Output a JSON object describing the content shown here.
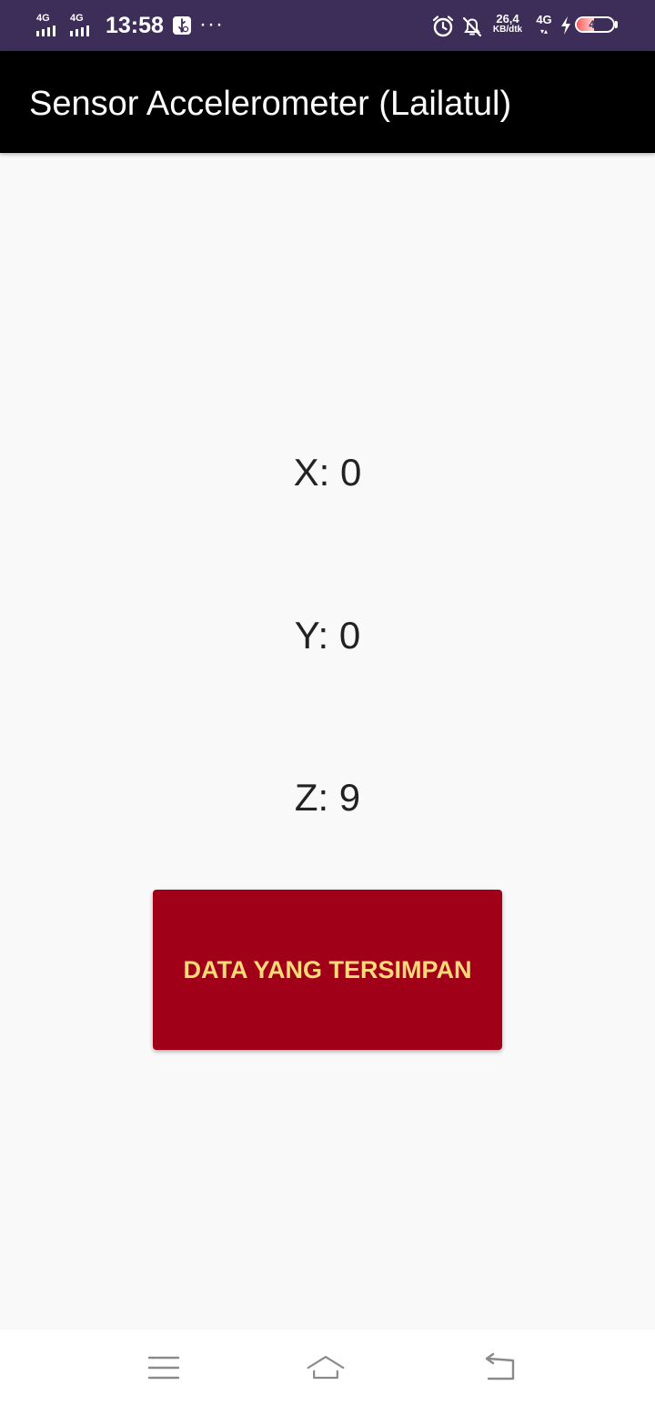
{
  "status_bar": {
    "sim1_network": "4G",
    "sim2_network": "4G",
    "time": "13:58",
    "more_indicator": "···",
    "net_speed_value": "26,4",
    "net_speed_unit": "KB/dtk",
    "data_network": "4G",
    "data_activity": "▾▴",
    "battery_level": "47",
    "battery_fraction": 0.47,
    "icons": [
      "signal-icon",
      "usb-debug-icon",
      "alarm-icon",
      "bell-off-icon",
      "charging-bolt-icon",
      "battery-icon"
    ],
    "background_color": "#3d2e59"
  },
  "app_bar": {
    "title": "Sensor Accelerometer (Lailatul)",
    "background_color": "#000000"
  },
  "readings": {
    "x_text": "X: 0",
    "y_text": "Y: 0",
    "z_text": "Z: 9"
  },
  "main": {
    "saved_data_button_label": "DATA YANG TERSIMPAN",
    "button_color": "#a10019",
    "button_text_color": "#ffd97a"
  },
  "nav_bar": {
    "icons": [
      "menu-icon",
      "home-icon",
      "back-icon"
    ]
  }
}
